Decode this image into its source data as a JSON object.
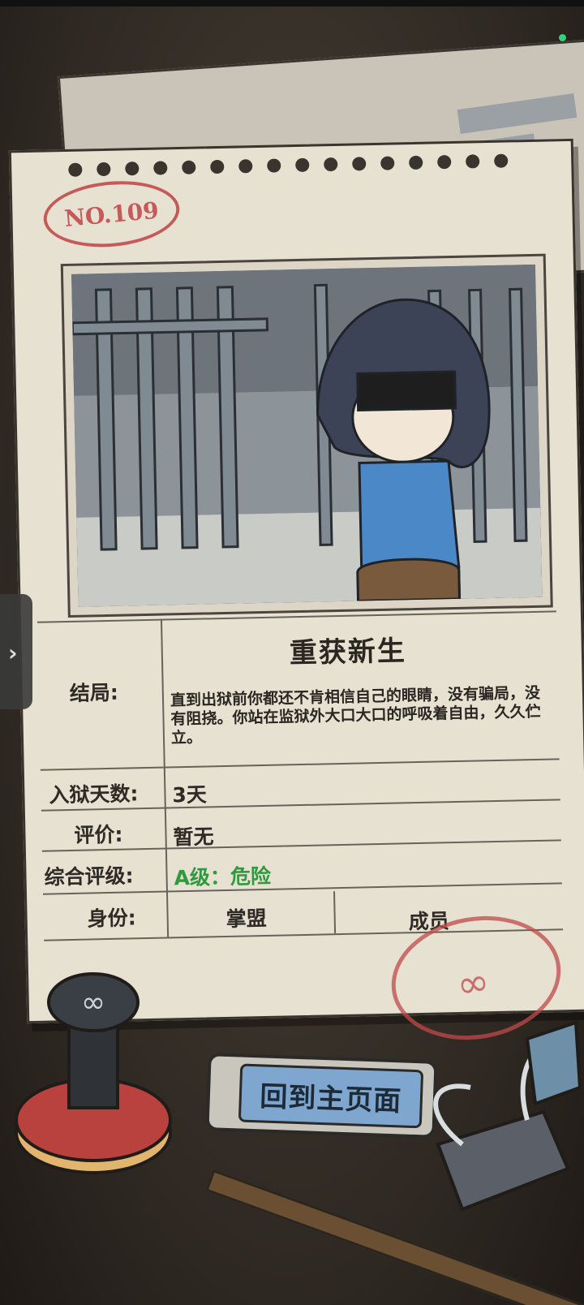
{
  "card": {
    "number": "NO.109",
    "ending_label": "结局:",
    "ending_title": "重获新生",
    "ending_description": "直到出狱前你都还不肯相信自己的眼睛，没有骗局，没有阻挠。你站在监狱外大口大口的呼吸着自由，久久伫立。",
    "days_label": "入狱天数:",
    "days_value": "3天",
    "review_label": "评价:",
    "review_value": "暂无",
    "grade_label": "综合评级:",
    "grade_value": "A级：危险",
    "identity_label": "身份:",
    "identity_org": "掌盟",
    "identity_role": "成员"
  },
  "actions": {
    "home_label": "回到主页面"
  },
  "icons": {
    "side_tab": "chevron-right-icon",
    "stamp": "infinity-icon"
  },
  "colors": {
    "grade_green": "#2f9a3d",
    "seal_red": "#c55a5a",
    "button_blue": "#7ea6cf"
  }
}
